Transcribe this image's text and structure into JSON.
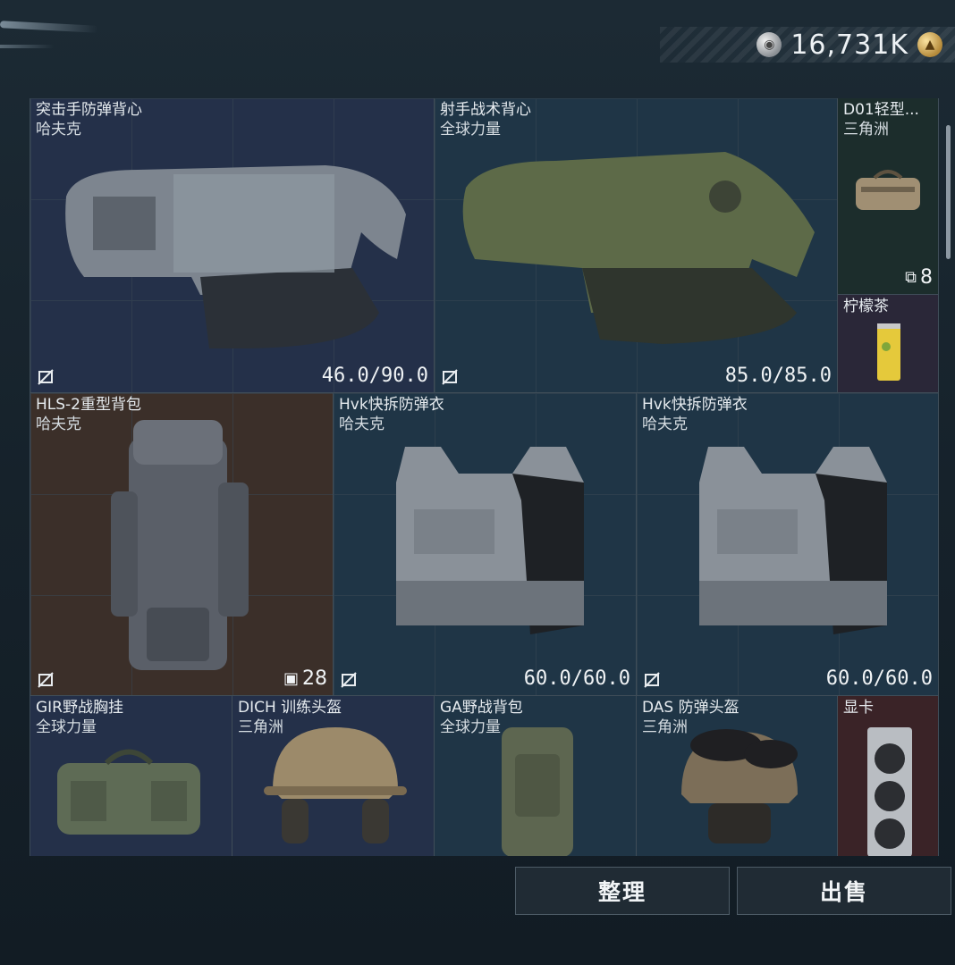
{
  "currency": {
    "value": "16,731K",
    "coin_icon": "silver-coin-icon",
    "premium_icon": "gold-triangle-coin-icon"
  },
  "items": [
    {
      "name": "突击手防弹背心",
      "brand": "哈夫克",
      "durability": "46.0/90.0"
    },
    {
      "name": "射手战术背心",
      "brand": "全球力量",
      "durability": "85.0/85.0"
    },
    {
      "name": "D01轻型...",
      "brand": "三角洲",
      "stack": "8"
    },
    {
      "name": "柠檬茶",
      "brand": ""
    },
    {
      "name": "HLS-2重型背包",
      "brand": "哈夫克",
      "capacity": "28"
    },
    {
      "name": "Hvk快拆防弹衣",
      "brand": "哈夫克",
      "durability": "60.0/60.0"
    },
    {
      "name": "Hvk快拆防弹衣",
      "brand": "哈夫克",
      "durability": "60.0/60.0"
    },
    {
      "name": "GIR野战胸挂",
      "brand": "全球力量"
    },
    {
      "name": "DICH 训练头盔",
      "brand": "三角洲"
    },
    {
      "name": "GA野战背包",
      "brand": "全球力量"
    },
    {
      "name": "DAS 防弹头盔",
      "brand": "三角洲"
    },
    {
      "name": "显卡",
      "brand": ""
    }
  ],
  "buttons": {
    "organize": "整理",
    "sell": "出售"
  }
}
